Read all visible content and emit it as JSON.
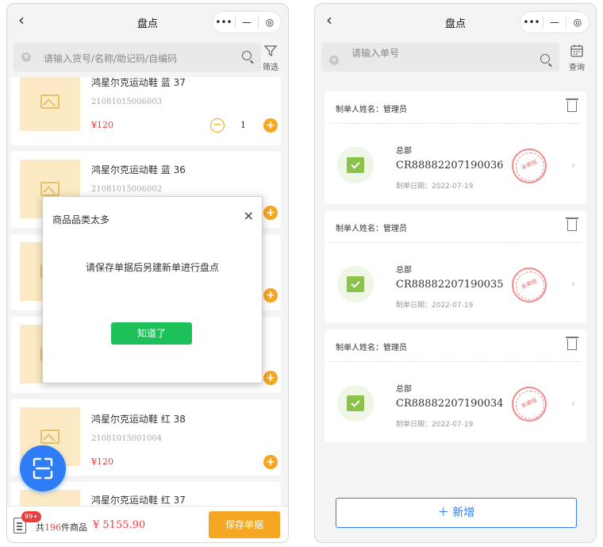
{
  "left": {
    "nav": {
      "title": "盘点",
      "back": "‹",
      "more": "•••",
      "minimize": "—",
      "target": "◎"
    },
    "search": {
      "placeholder": "请输入货号/名称/助记码/自编码",
      "filter_label": "筛选"
    },
    "products": [
      {
        "name": "鸿星尔克运动鞋 蓝 37",
        "code": "21081015006003",
        "price": "¥120",
        "qty": "1",
        "show_qty": true
      },
      {
        "name": "鸿星尔克运动鞋 蓝 36",
        "code": "21081015006002",
        "price": "",
        "qty": "",
        "show_qty": false
      },
      {
        "name": "",
        "code": "",
        "price": "",
        "qty": "",
        "show_qty": false
      },
      {
        "name": "",
        "code": "",
        "price": "",
        "qty": "",
        "show_qty": false
      },
      {
        "name": "鸿星尔克运动鞋 红 38",
        "code": "21081015001004",
        "price": "¥120",
        "qty": "",
        "show_qty": false
      },
      {
        "name": "鸿星尔克运动鞋 红 37",
        "code": "",
        "price": "",
        "qty": "",
        "show_qty": false
      }
    ],
    "modal": {
      "title": "商品品类太多",
      "close": "×",
      "message": "请保存单据后另建新单进行盘点",
      "confirm": "知道了"
    },
    "bottom": {
      "badge": "99+",
      "total_prefix": "共",
      "total_count": "196",
      "total_suffix": "件商品",
      "total_amount": "¥ 5155.90",
      "save": "保存单据"
    }
  },
  "right": {
    "nav": {
      "title": "盘点",
      "back": "‹",
      "more": "•••",
      "minimize": "—",
      "target": "◎"
    },
    "search": {
      "placeholder": "请输入单号",
      "query_label": "查询"
    },
    "orders": [
      {
        "maker": "制单人姓名：管理员",
        "branch": "总部",
        "code": "CR88882207190036",
        "date": "制单日期：2022-07-19",
        "stamp": "未审核"
      },
      {
        "maker": "制单人姓名：管理员",
        "branch": "总部",
        "code": "CR88882207190035",
        "date": "制单日期：2022-07-19",
        "stamp": "未审核"
      },
      {
        "maker": "制单人姓名：管理员",
        "branch": "总部",
        "code": "CR88882207190034",
        "date": "制单日期：2022-07-19",
        "stamp": "未审核"
      }
    ],
    "add": {
      "plus": "＋",
      "label": "新增"
    }
  },
  "colors": {
    "accent": "#f5a623",
    "price": "#f03c3c",
    "primary": "#2f7df6",
    "confirm": "#1ec05a",
    "stamp": "#ee6b6e"
  }
}
